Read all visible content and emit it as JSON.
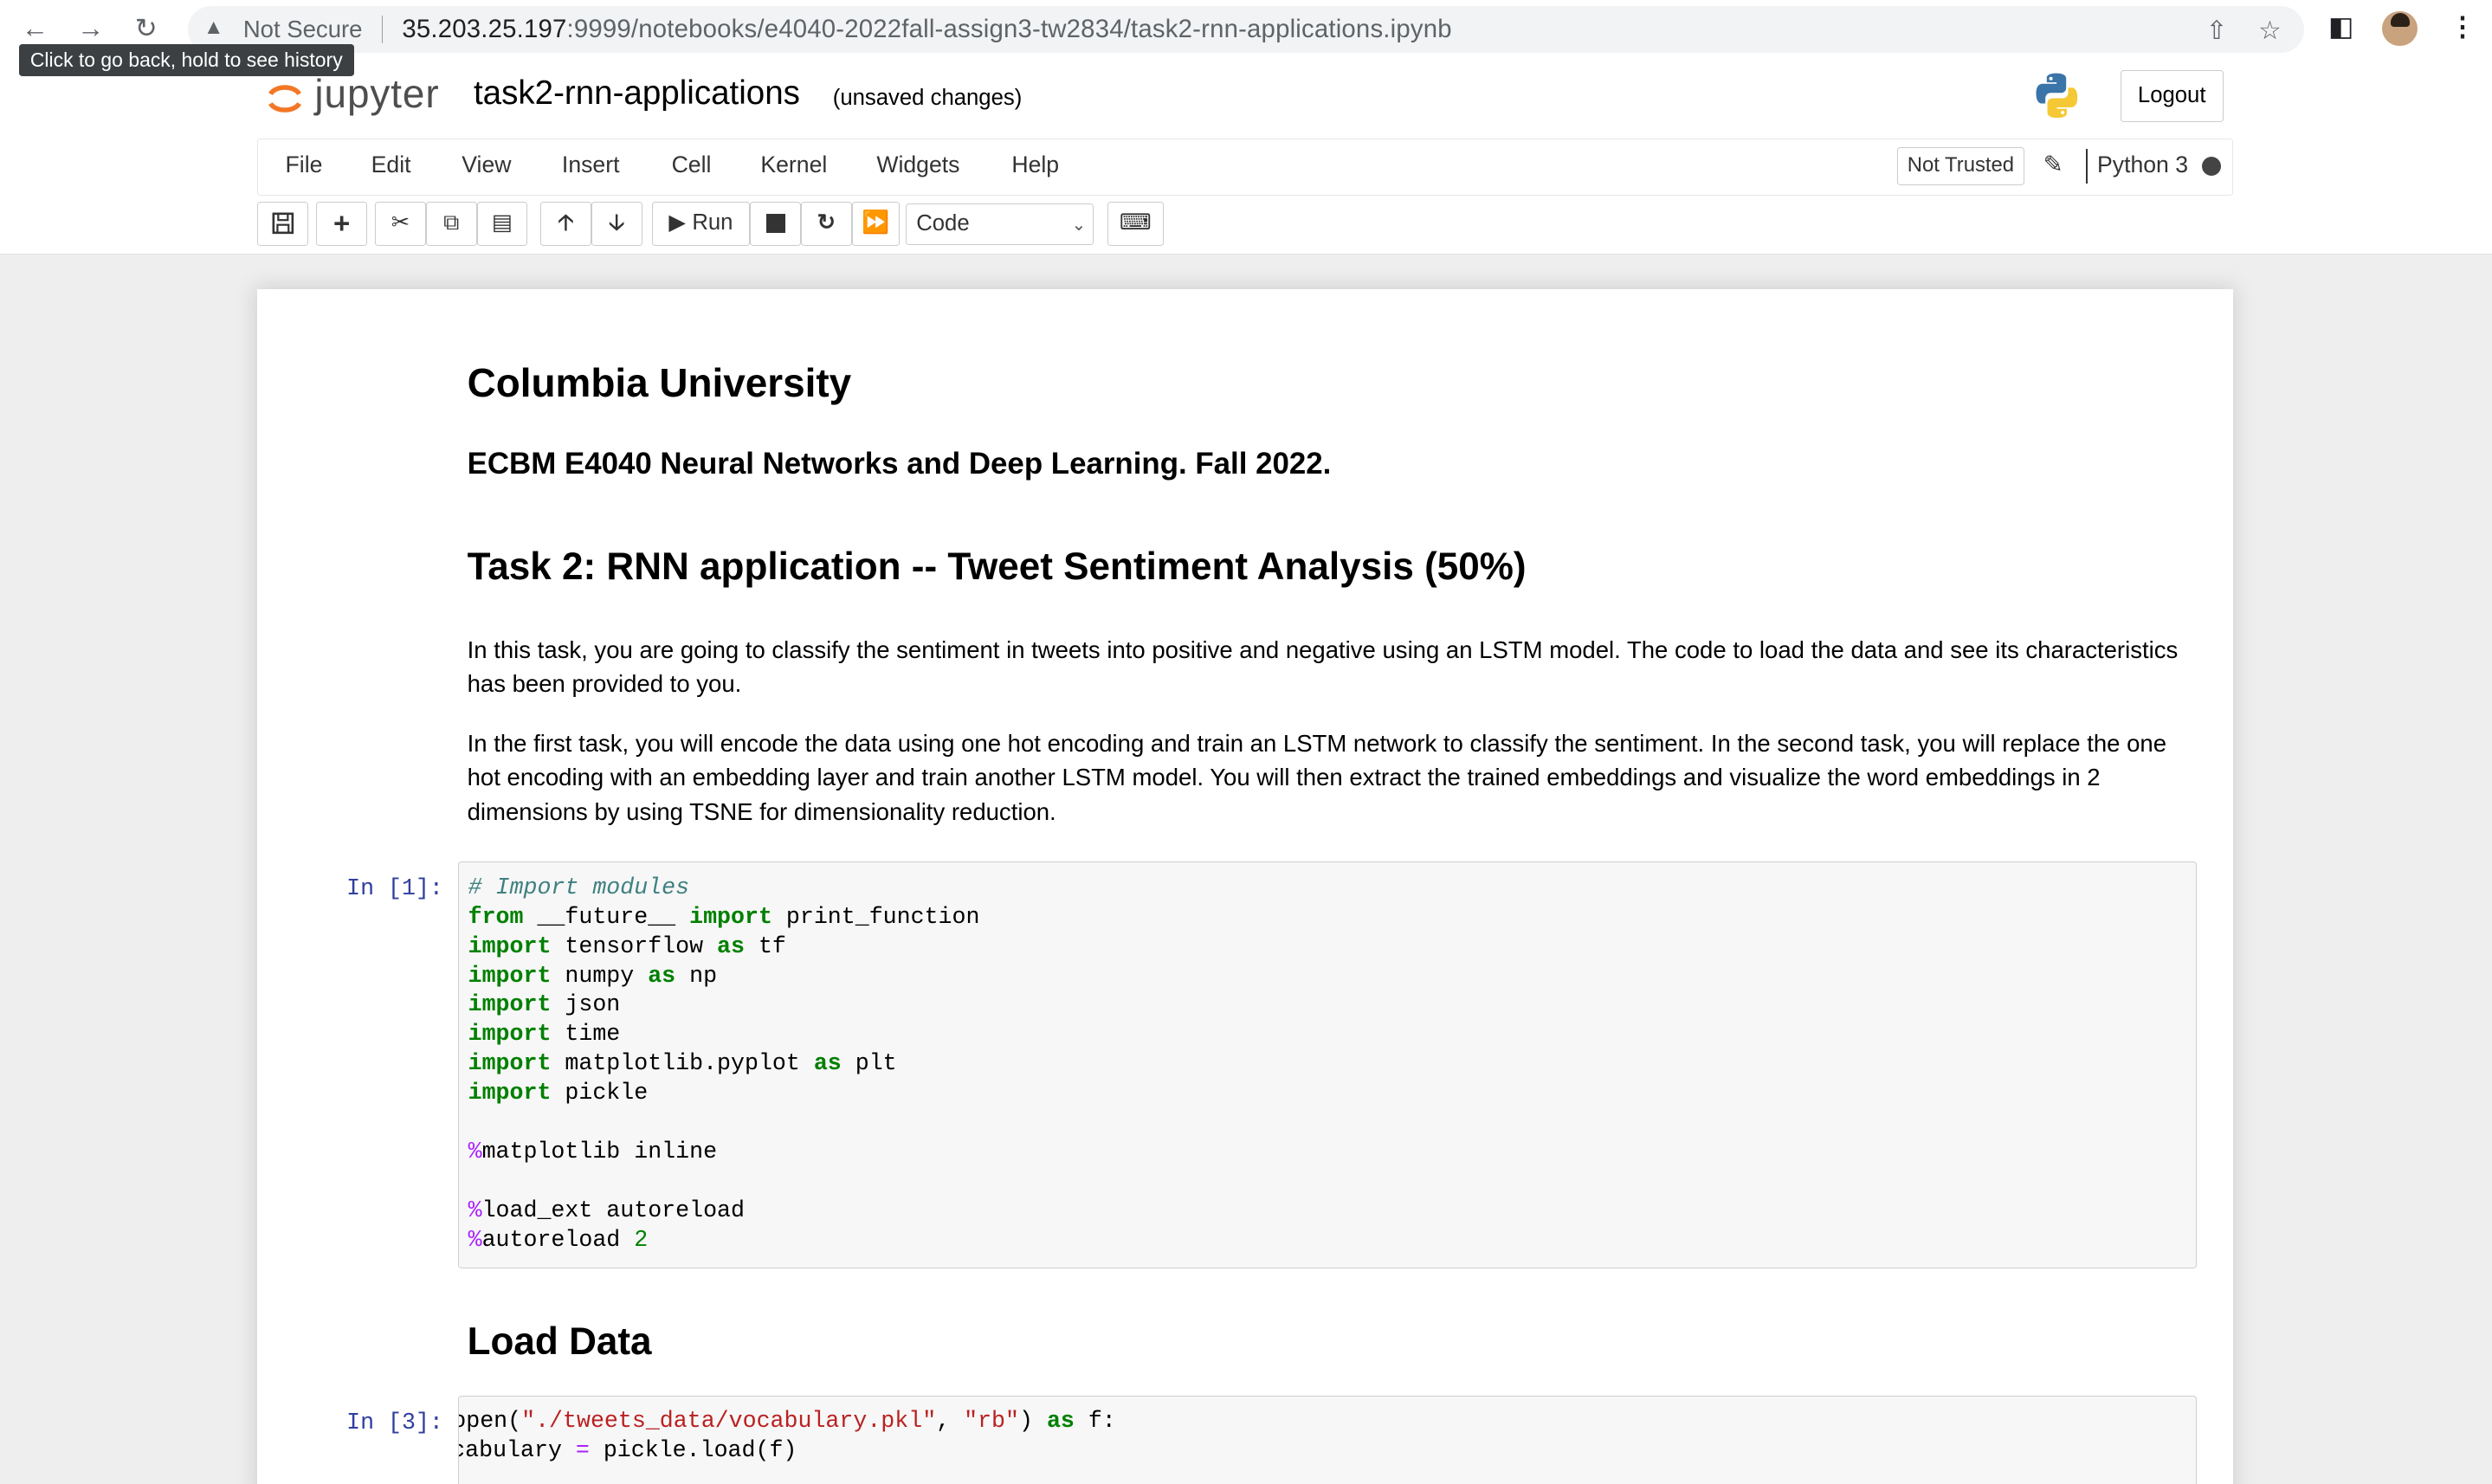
{
  "browser": {
    "security_label": "Not Secure",
    "url_host": "35.203.25.197",
    "url_rest": ":9999/notebooks/e4040-2022fall-assign3-tw2834/task2-rnn-applications.ipynb",
    "back_tooltip": "Click to go back, hold to see history"
  },
  "jupyter": {
    "logo_text": "jupyter",
    "notebook_name": "task2-rnn-applications",
    "autosave_status": "(unsaved changes)",
    "logout_label": "Logout",
    "menus": [
      "File",
      "Edit",
      "View",
      "Insert",
      "Cell",
      "Kernel",
      "Widgets",
      "Help"
    ],
    "trust_status": "Not Trusted",
    "kernel_name": "Python 3",
    "run_label": "Run",
    "cell_type": "Code"
  },
  "notebook": {
    "h1": "Columbia University",
    "h3": "ECBM E4040 Neural Networks and Deep Learning. Fall 2022.",
    "task_title": "Task 2: RNN application -- Tweet Sentiment Analysis (50%)",
    "para1": "In this task, you are going to classify the sentiment in tweets into positive and negative using an LSTM model. The code to load the data and see its characteristics has been provided to you.",
    "para2": "In the first task, you will encode the data using one hot encoding and train an LSTM network to classify the sentiment. In the second task, you will replace the one hot encoding with an embedding layer and train another LSTM model. You will then extract the trained embeddings and visualize the word embeddings in 2 dimensions by using TSNE for dimensionality reduction.",
    "cell1_prompt": "In [1]:",
    "load_data_heading": "Load Data",
    "cell2_prompt": "In [3]:"
  },
  "code_cell_1": [
    "# Import modules",
    "from __future__ import print_function",
    "import tensorflow as tf",
    "import numpy as np",
    "import json",
    "import time",
    "import matplotlib.pyplot as plt",
    "import pickle",
    "%matplotlib inline",
    "%load_ext autoreload",
    "%autoreload 2"
  ],
  "code_cell_2": [
    "open(\"./tweets_data/vocabulary.pkl\", \"rb\") as f:",
    "vocabulary = pickle.load(f)"
  ],
  "colors": {
    "jupyter_orange": "#f37726",
    "prompt_blue": "#303f9f",
    "keyword_green": "#008000",
    "comment_teal": "#408080",
    "magic_purple": "#aa22ff",
    "string_red": "#ba2121"
  }
}
